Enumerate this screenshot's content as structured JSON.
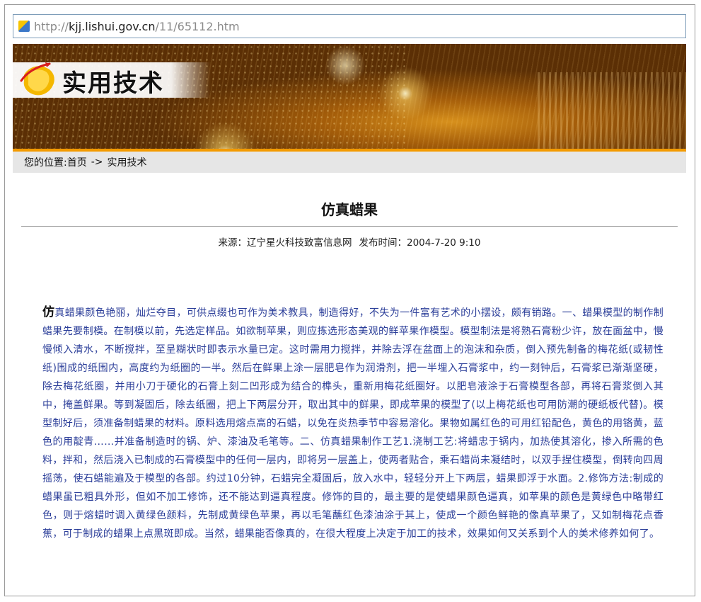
{
  "browser": {
    "url_scheme": "http://",
    "url_host": "kjj.lishui.gov.cn",
    "url_path": "/11/65112.htm"
  },
  "banner": {
    "title": "实用技术",
    "colors": {
      "accent_strip": "#f39a00",
      "banner_base": "#a45d0a"
    }
  },
  "breadcrumb": {
    "prefix": "您的位置:",
    "home": "首页",
    "separator": "->",
    "current": "实用技术"
  },
  "article": {
    "title": "仿真蜡果",
    "source_label": "来源：",
    "source": "辽宁星火科技致富信息网",
    "date_label": "发布时间：",
    "date": "2004-7-20 9:10",
    "first_char": "仿",
    "body": "真蜡果颜色艳丽，灿烂夺目，可供点缀也可作为美术教具，制造得好，不失为一件富有艺术的小摆设，颇有销路。一、蜡果模型的制作制蜡果先要制模。在制模以前，先选定样品。如欲制苹果，则应拣选形态美观的鲜苹果作模型。模型制法是将熟石膏粉少许，放在面盆中，慢慢倾入清水，不断搅拌，至呈糊状时即表示水量已定。这时需用力搅拌，并除去浮在盆面上的泡沫和杂质，倒入预先制备的梅花纸(或韧性纸)围成的纸围内，高度约为纸圈的一半。然后在鲜果上涂一层肥皂作为润滑剂，把一半埋入石膏浆中，约一刻钟后，石膏浆已渐渐坚硬，除去梅花纸圈，并用小刀于硬化的石膏上刻二凹形成为结合的榫头，重新用梅花纸圈好。以肥皂液涂于石膏模型各部，再将石膏浆倒入其中，掩盖鲜果。等到凝固后，除去纸圈，把上下两层分开，取出其中的鲜果，即成苹果的模型了(以上梅花纸也可用防潮的硬纸板代替)。模型制好后，须准备制蜡果的材料。原料选用熔点高的石蜡，以免在炎热季节中容易溶化。果物如属红色的可用红铅配色，黄色的用铬黄，蓝色的用靛青……并准备制造时的锅、炉、漆油及毛笔等。二、仿真蜡果制作工艺1.浇制工艺:将蜡忠于锅内，加热使其溶化，掺入所需的色料，拌和，然后浇入已制成的石膏模型中的任何一层内，即将另一层盖上，使两者贴合，乘石蜡尚未凝结时，以双手捏住模型，倒转向四周摇荡，使石蜡能遍及于模型的各部。约过10分钟，石蜡完全凝固后，放入水中，轻轻分开上下两层，蜡果即浮于水面。2.修饰方法:制成的蜡果虽已粗具外形，但如不加工修饰，还不能达到逼真程度。修饰的目的，最主要的是使蜡果颜色逼真，如苹果的颜色是黄绿色中略带红色，则于熔蜡时调入黄绿色颜料，先制成黄绿色苹果，再以毛笔蘸红色漆油涂于其上，使成一个颜色鲜艳的像真苹果了，又如制梅花点香蕉，可于制成的蜡果上点黑斑即成。当然，蜡果能否像真的，在很大程度上决定于加工的技术，效果如何又关系到个人的美术修养如何了。"
  }
}
